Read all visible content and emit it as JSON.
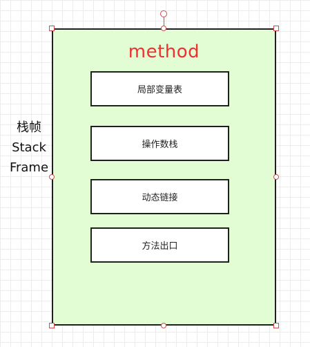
{
  "diagram": {
    "frame_title": "method",
    "side_label": {
      "line1": "栈帧",
      "line2": "Stack",
      "line3": "Frame"
    },
    "boxes": [
      {
        "label": "局部变量表"
      },
      {
        "label": "操作数栈"
      },
      {
        "label": "动态链接"
      },
      {
        "label": "方法出口"
      }
    ]
  },
  "colors": {
    "frame_fill": "#e2fcd4",
    "title_color": "#f03030",
    "border": "#1f1f1f",
    "selection_handle": "#d04a4a"
  }
}
